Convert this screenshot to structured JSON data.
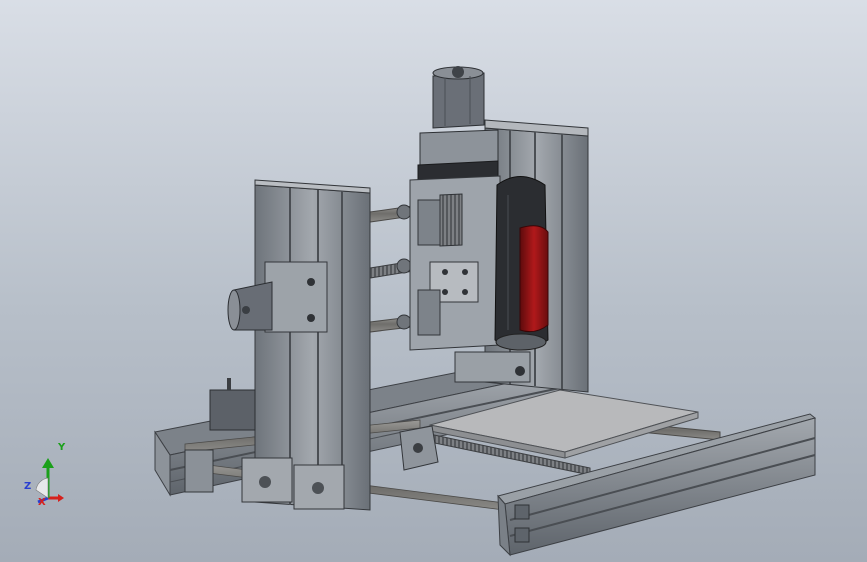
{
  "viewport": {
    "background_top": "#d9dee6",
    "background_bottom": "#a4acb7"
  },
  "model": {
    "parts": [
      "aluminum-extrusion-frame",
      "x-stepper-motor",
      "z-stepper-motor",
      "spindle-motor",
      "lead-screws",
      "linear-rails",
      "bearing-blocks",
      "work-bed"
    ],
    "colors": {
      "aluminum": "#8e949b",
      "aluminum_dark": "#5c6168",
      "motor": "#6a6f77",
      "spindle_red": "#a01517",
      "spindle_black": "#2b2d31",
      "bed": "#b8b9bb"
    }
  },
  "triad": {
    "x_label": "X",
    "y_label": "Y",
    "z_label": "Z",
    "colors": {
      "x": "#d6201c",
      "y": "#1aa01a",
      "z": "#2a3fd0"
    }
  }
}
